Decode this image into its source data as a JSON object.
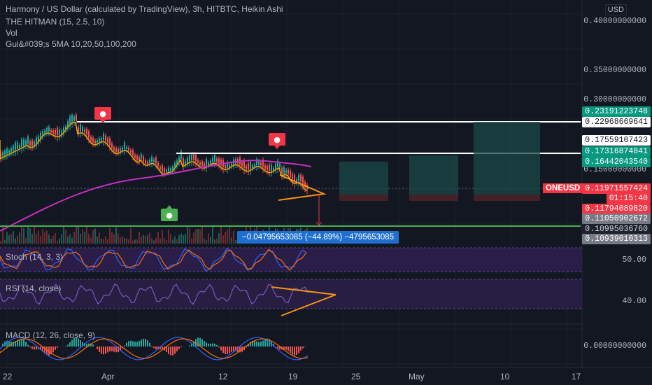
{
  "legend": {
    "title": "Harmony / US Dollar (calculated by TradingView), 3h, HITBTC, Heikin Ashi",
    "line2": "THE HITMAN (15, 2.5, 10)",
    "line3": "Vol",
    "line4": "Gui&#039;s 5MA 10,20,50,100,200"
  },
  "currency": "USD",
  "price_axis": {
    "ticks": [
      "0.40000000000",
      "0.35000000000",
      "0.30000000000",
      "0.15000000000"
    ],
    "labels": [
      {
        "text": "0.23191223748",
        "bg": "#089981",
        "fg": "#ffffff"
      },
      {
        "text": "0.22968669641",
        "bg": "#ffffff",
        "fg": "#131722"
      },
      {
        "text": "0.17559107423",
        "bg": "#ffffff",
        "fg": "#131722"
      },
      {
        "text": "0.17316874841",
        "bg": "#089981",
        "fg": "#ffffff"
      },
      {
        "text": "0.16442043540",
        "bg": "#089981",
        "fg": "#ffffff"
      },
      {
        "text": "0.11971557424",
        "bg": "#f23645",
        "fg": "#ffffff"
      },
      {
        "text": "01:15:40",
        "bg": "#f23645",
        "fg": "#ffffff"
      },
      {
        "text": "0.11794089820",
        "bg": "#f23645",
        "fg": "#ffffff"
      },
      {
        "text": "0.11050902672",
        "bg": "#787b86",
        "fg": "#ffffff"
      },
      {
        "text": "0.10995036760",
        "bg": "#1e222d",
        "fg": "#d1d4dc"
      },
      {
        "text": "0.10939010313",
        "bg": "#787b86",
        "fg": "#ffffff"
      }
    ]
  },
  "symbol_label": "ONEUSD",
  "measure_label": "−0.04795653085 (−44.89%) −4795653085",
  "panes": {
    "stoch": {
      "label": "Stoch (14, 3, 3)",
      "tick": "50.00"
    },
    "rsi": {
      "label": "RSI (14, close)",
      "tick": "40.00"
    },
    "macd": {
      "label": "MACD (12, 26, close, 9)",
      "tick": "0.00000000000"
    }
  },
  "time_axis": [
    "22",
    "Apr",
    "12",
    "19",
    "25",
    "May",
    "10",
    "17"
  ],
  "colors": {
    "background": "#131722",
    "up": "#26a69a",
    "down": "#ef5350",
    "ma_magenta": "#c32fc0",
    "ma_orange": "#f0a30a",
    "support_green": "#4caf50",
    "pattern_orange": "#f7931a",
    "stoch_purple": "#2e1f4d",
    "rsi_purple": "#7e57c2"
  },
  "icons": [
    "bear-marker-icon",
    "bear-marker-icon",
    "bull-marker-icon"
  ]
}
